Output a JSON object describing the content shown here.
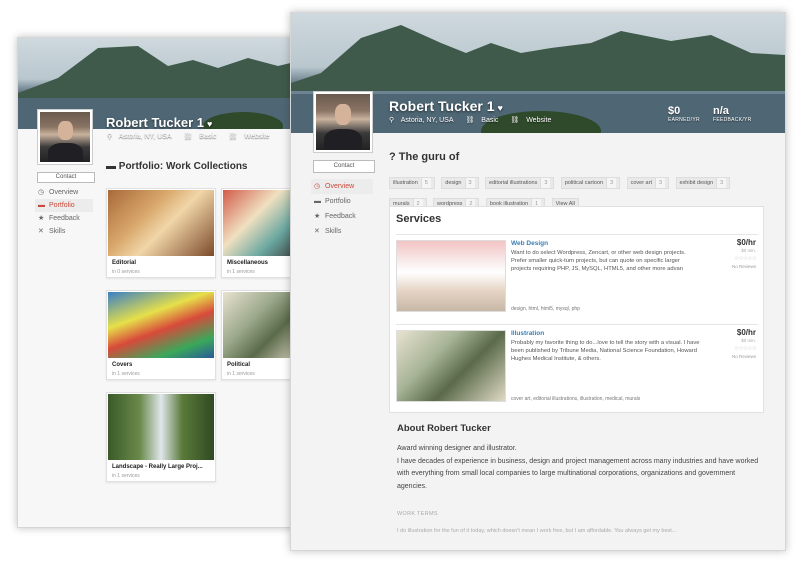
{
  "profile": {
    "name": "Robert Tucker 1",
    "heart": "♥",
    "location": "Astoria, NY, USA",
    "plan": "Basic",
    "website": "Website",
    "contact_label": "Contact"
  },
  "stats": {
    "earned_value": "$0",
    "earned_label": "EARNED/YR",
    "feedback_value": "n/a",
    "feedback_label": "FEEDBACK/YR"
  },
  "back_nav": [
    {
      "icon": "◷",
      "label": "Overview"
    },
    {
      "icon": "▬",
      "label": "Portfolio"
    },
    {
      "icon": "★",
      "label": "Feedback"
    },
    {
      "icon": "✕",
      "label": "Skills"
    }
  ],
  "front_nav": [
    {
      "icon": "◷",
      "label": "Overview"
    },
    {
      "icon": "▬",
      "label": "Portfolio"
    },
    {
      "icon": "★",
      "label": "Feedback"
    },
    {
      "icon": "✕",
      "label": "Skills"
    }
  ],
  "portfolio": {
    "title": "Portfolio: Work Collections",
    "cards": [
      {
        "title": "Editorial",
        "sub": "in 0 services"
      },
      {
        "title": "Miscellaneous",
        "sub": "in 1 services"
      },
      {
        "title": "Covers",
        "sub": "in 1 services"
      },
      {
        "title": "Political",
        "sub": "in 1 services"
      },
      {
        "title": "Landscape - Really Large Proj...",
        "sub": "in 1 services"
      }
    ]
  },
  "guru": {
    "title": "The guru of",
    "tags": [
      {
        "label": "illustration",
        "count": "5"
      },
      {
        "label": "design",
        "count": "3"
      },
      {
        "label": "editorial illustrations",
        "count": "3"
      },
      {
        "label": "political cartoon",
        "count": "3"
      },
      {
        "label": "cover art",
        "count": "3"
      },
      {
        "label": "exhibit design",
        "count": "3"
      },
      {
        "label": "murals",
        "count": "2"
      },
      {
        "label": "wordpress",
        "count": "2"
      },
      {
        "label": "book illustration",
        "count": "1"
      }
    ],
    "view_all": "View All"
  },
  "services": {
    "title": "Services",
    "items": [
      {
        "title": "Web Design",
        "desc": "Want to do select Wordpress, Zencart, or other web design projects. Prefer smaller quick-turn projects, but can quote on specific larger projects requiring PHP, JS, MySQL, HTML5, and other more advan",
        "tags": "design, html, html5, mysql, php",
        "price": "$0/hr",
        "min": "$0 min.",
        "stars": "☆☆☆☆☆",
        "reviews": "No Reviews"
      },
      {
        "title": "Illustration",
        "desc": "Probably my favorite thing to do...love to tell the story with a visual. I have been published by Tribune Media, National Science Foundation, Howard Hughes Medical Institute, & others.",
        "tags": "cover art,  editorial illustrations,  illustration,  medical,  murals",
        "price": "$0/hr",
        "min": "$0 min.",
        "stars": "☆☆☆☆☆",
        "reviews": "No Reviews"
      }
    ]
  },
  "about": {
    "title": "About Robert Tucker",
    "line1": "Award winning designer and illustrator.",
    "line2": "I have decades of experience in business, design and project management across many industries and have worked with everything from small local companies to large multinational corporations, organizations and government agencies.",
    "work_terms_label": "WORK TERMS",
    "work_terms_text": "I do illustration for the fun of it today, which doesn't mean I work free, but I am affordable. You always get my best..."
  },
  "colors": {
    "accent_red": "#c84a3a",
    "link_blue": "#3a7fb5"
  }
}
